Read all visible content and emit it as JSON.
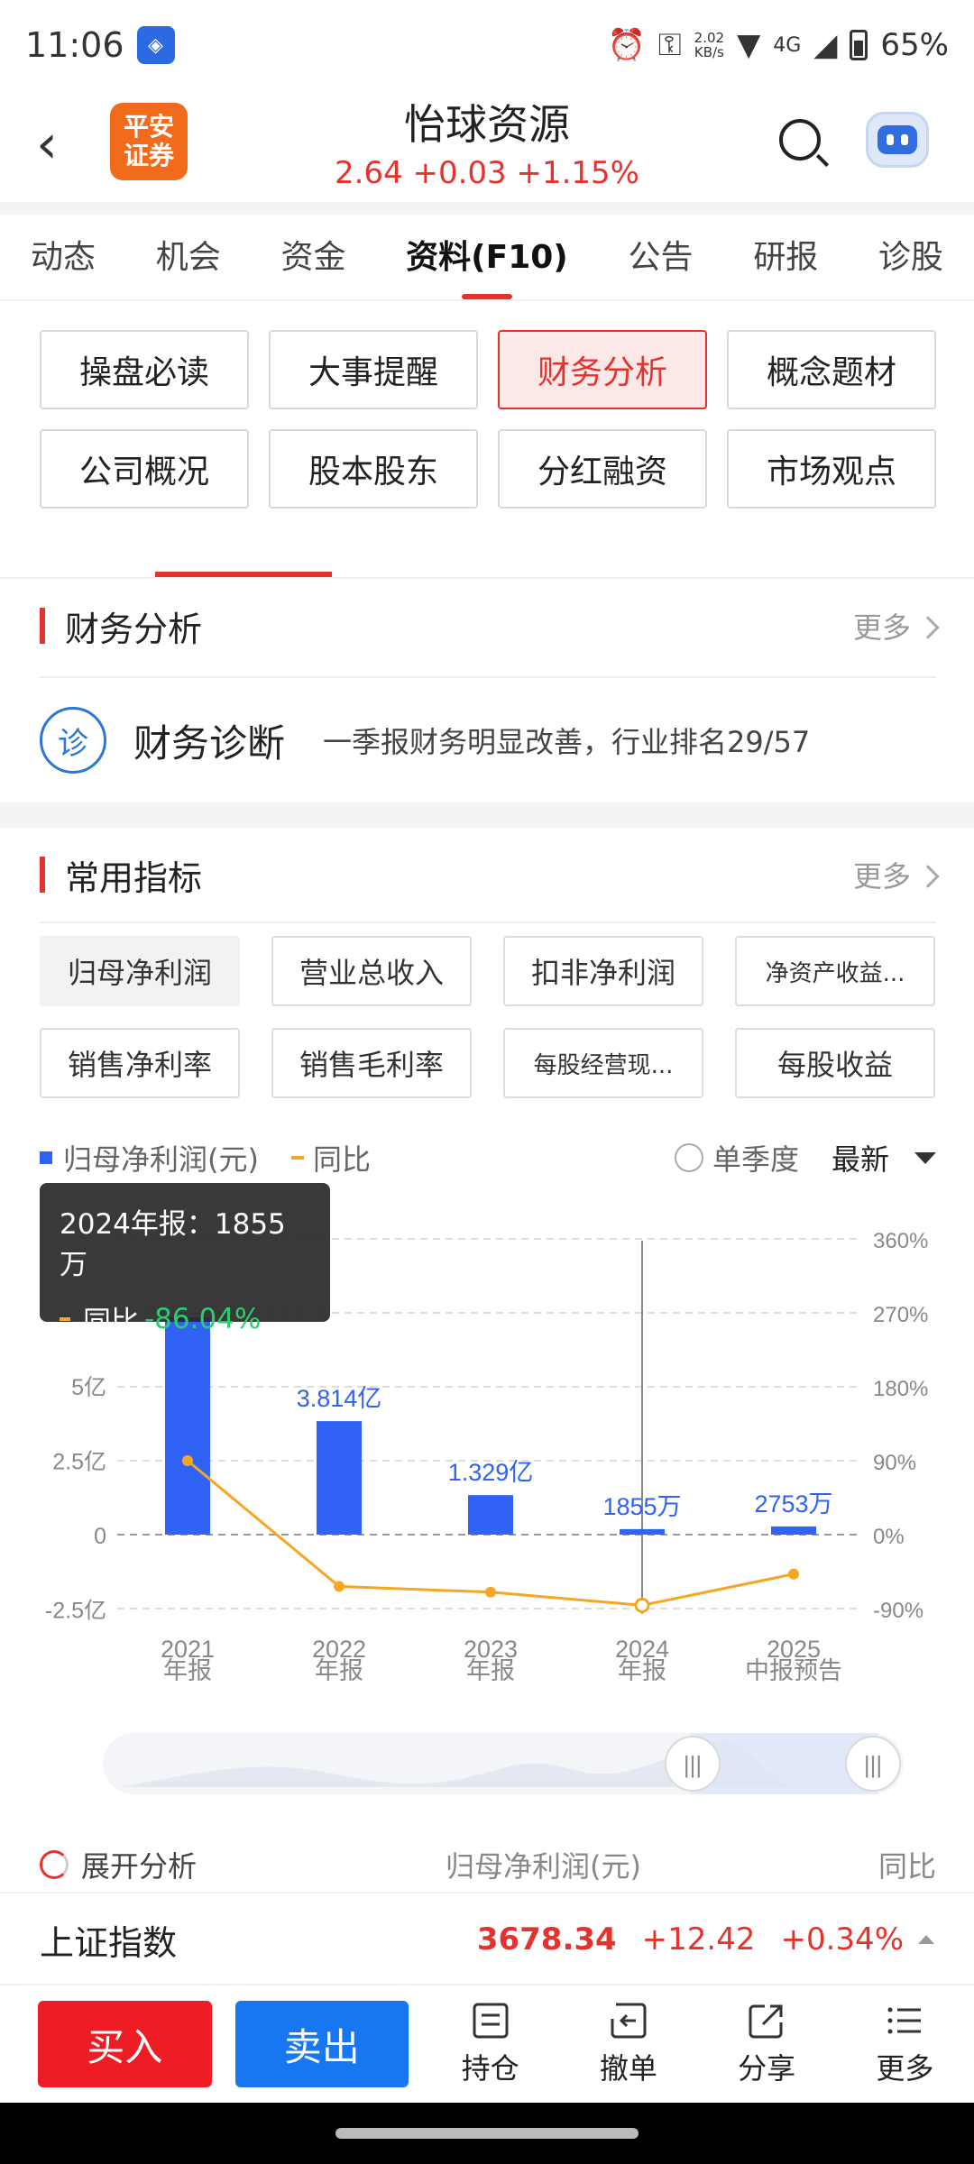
{
  "status": {
    "time": "11:06",
    "speed_top": "2.02",
    "speed_bottom": "KB/s",
    "network": "4G",
    "battery": "65%"
  },
  "header": {
    "logo_line1": "平安",
    "logo_line2": "证券",
    "title": "怡球资源",
    "quote": "2.64 +0.03 +1.15%"
  },
  "tabs": [
    "动态",
    "机会",
    "资金",
    "资料(F10)",
    "公告",
    "研报",
    "诊股"
  ],
  "sub_buttons": [
    "操盘必读",
    "大事提醒",
    "财务分析",
    "概念题材",
    "公司概况",
    "股本股东",
    "分红融资",
    "市场观点"
  ],
  "finance": {
    "title": "财务分析",
    "more": "更多",
    "diag_icon": "诊",
    "diag_title": "财务诊断",
    "diag_text": "一季报财务明显改善，行业排名29/57"
  },
  "indicators": {
    "title": "常用指标",
    "more": "更多",
    "chips": [
      "归母净利润",
      "营业总收入",
      "扣非净利润",
      "净资产收益...",
      "销售净利率",
      "销售毛利率",
      "每股经营现...",
      "每股收益"
    ]
  },
  "legend": {
    "series1": "归母净利润(元)",
    "series2": "同比",
    "quarter": "单季度",
    "latest": "最新"
  },
  "tooltip": {
    "line1": "2024年报：1855万",
    "label": "同比",
    "value": "-86.04%"
  },
  "chart_data": {
    "type": "bar",
    "categories": [
      [
        "2021",
        "年报"
      ],
      [
        "2022",
        "年报"
      ],
      [
        "2023",
        "年报"
      ],
      [
        "2024",
        "年报"
      ],
      [
        "2025",
        "中报预告"
      ]
    ],
    "series": [
      {
        "name": "归母净利润(元)",
        "values": [
          7.3,
          3.814,
          1.329,
          0.1855,
          0.2753
        ],
        "labels": [
          "",
          "3.814亿",
          "1.329亿",
          "1855万",
          "2753万"
        ],
        "color": "#2f62f5"
      },
      {
        "name": "同比",
        "type": "line",
        "values": [
          90,
          -63,
          -70,
          -86.04,
          -48
        ],
        "color": "#f5a623"
      }
    ],
    "y_left": {
      "ticks": [
        -2.5,
        0,
        2.5,
        5
      ],
      "tick_labels": [
        "-2.5亿",
        "0",
        "2.5亿",
        "5亿"
      ],
      "ylim": [
        -2.5,
        7.5
      ]
    },
    "y_right": {
      "ticks": [
        -90,
        0,
        90,
        180,
        270,
        360
      ],
      "tick_labels": [
        "-90%",
        "0%",
        "90%",
        "180%",
        "270%",
        "360%"
      ]
    },
    "highlight_index": 3
  },
  "analysis": {
    "expand": "展开分析",
    "column1": "归母净利润(元)",
    "column2": "同比"
  },
  "index": {
    "name": "上证指数",
    "value": "3678.34",
    "change": "+12.42",
    "pct": "+0.34%"
  },
  "bottom": {
    "buy": "买入",
    "sell": "卖出",
    "hold": "持仓",
    "cancel": "撤单",
    "share": "分享",
    "more": "更多"
  }
}
